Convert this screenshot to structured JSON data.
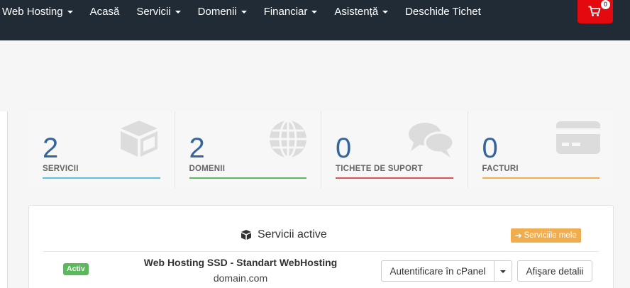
{
  "nav": {
    "items": [
      {
        "label": "Web Hosting",
        "dropdown": true
      },
      {
        "label": "Acasă",
        "dropdown": false
      },
      {
        "label": "Servicii",
        "dropdown": true
      },
      {
        "label": "Domenii",
        "dropdown": true
      },
      {
        "label": "Financiar",
        "dropdown": true
      },
      {
        "label": "Asistență",
        "dropdown": true
      },
      {
        "label": "Deschide Tichet",
        "dropdown": false
      }
    ],
    "cart_count": "0"
  },
  "tiles": [
    {
      "number": "2",
      "label": "SERVICII",
      "icon": "cube-icon",
      "color": "#5bc0de"
    },
    {
      "number": "2",
      "label": "DOMENII",
      "icon": "globe-icon",
      "color": "#5cb85c"
    },
    {
      "number": "0",
      "label": "TICHETE DE SUPORT",
      "icon": "comments-icon",
      "color": "#d9534f"
    },
    {
      "number": "0",
      "label": "FACTURI",
      "icon": "credit-card-icon",
      "color": "#f0ad4e"
    }
  ],
  "panel": {
    "title": "Servicii active",
    "my_services_label": "Serviciile mele",
    "service": {
      "status": "Activ",
      "name": "Web Hosting SSD - Standart WebHosting",
      "domain": "domain.com",
      "login_label": "Autentificare în cPanel",
      "details_label": "Afişare detalii"
    }
  }
}
